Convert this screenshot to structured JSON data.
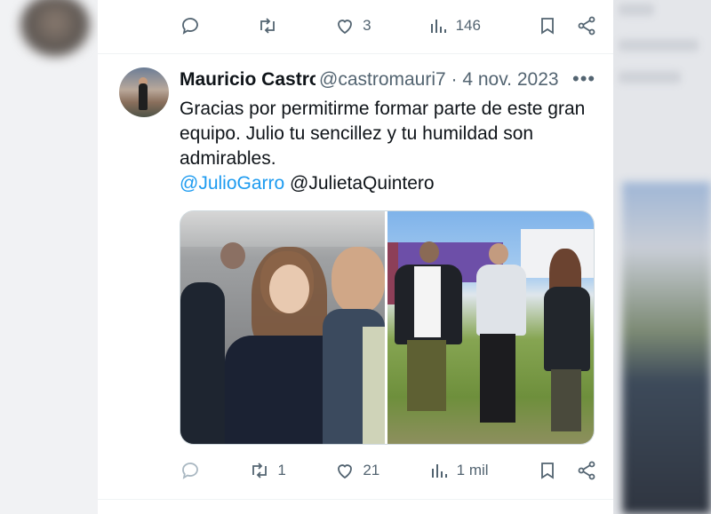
{
  "top_actions": {
    "likes": "3",
    "views": "146"
  },
  "tweet": {
    "author_name": "Mauricio Castro",
    "handle_date": "@castromauri7 · 4 nov. 2023",
    "more_label": "•••",
    "text": "Gracias por permitirme formar parte de este gran equipo. Julio tu sencillez y tu humildad son admirables.",
    "mention_1": "@JulioGarro",
    "mention_2": "@JulietaQuintero",
    "actions": {
      "retweets": "1",
      "likes": "21",
      "views": "1 mil"
    }
  },
  "colors": {
    "secondary_text": "#536471",
    "link": "#1d9bf0",
    "primary_text": "#0f1419"
  }
}
